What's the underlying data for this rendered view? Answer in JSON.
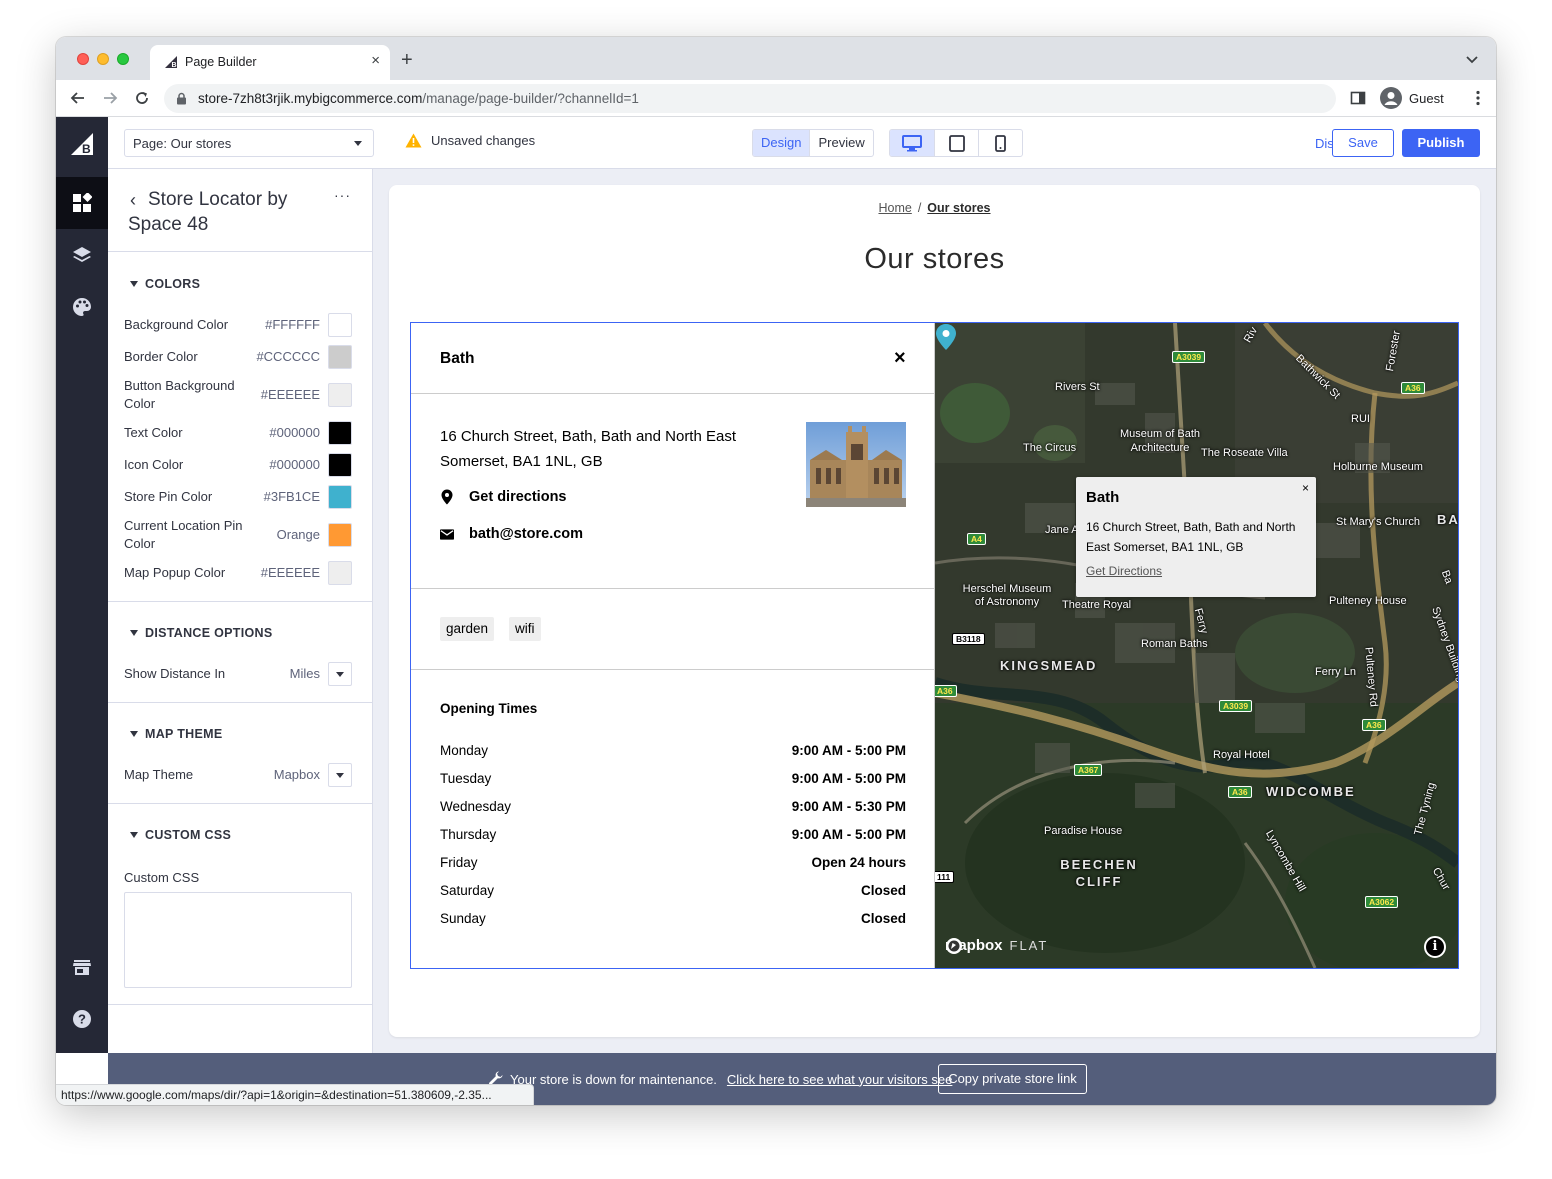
{
  "browser": {
    "tab_title": "Page Builder",
    "new_tab": "+",
    "tab_close": "×",
    "url_host": "store-7zh8t3rjik.mybigcommerce.com",
    "url_path": "/manage/page-builder/?channelId=1",
    "profile_label": "Guest",
    "status_url": "https://www.google.com/maps/dir/?api=1&origin=&destination=51.380609,-2.35..."
  },
  "topbar": {
    "page_select": "Page: Our stores",
    "unsaved": "Unsaved changes",
    "design": "Design",
    "preview": "Preview",
    "discard": "Discard",
    "save": "Save",
    "publish": "Publish"
  },
  "panel": {
    "title": "Store Locator by Space 48",
    "more": "···",
    "colors": {
      "heading": "COLORS",
      "rows": [
        {
          "label": "Background Color",
          "value": "#FFFFFF",
          "swatch": "#FFFFFF"
        },
        {
          "label": "Border Color",
          "value": "#CCCCCC",
          "swatch": "#CCCCCC"
        },
        {
          "label": "Button Background Color",
          "value": "#EEEEEE",
          "swatch": "#EEEEEE"
        },
        {
          "label": "Text Color",
          "value": "#000000",
          "swatch": "#000000"
        },
        {
          "label": "Icon Color",
          "value": "#000000",
          "swatch": "#000000"
        },
        {
          "label": "Store Pin Color",
          "value": "#3FB1CE",
          "swatch": "#3FB1CE"
        },
        {
          "label": "Current Location Pin Color",
          "value": "Orange",
          "swatch": "#FF9933"
        },
        {
          "label": "Map Popup Color",
          "value": "#EEEEEE",
          "swatch": "#EEEEEE"
        }
      ]
    },
    "distance": {
      "heading": "DISTANCE OPTIONS",
      "label": "Show Distance In",
      "value": "Miles"
    },
    "map_theme": {
      "heading": "MAP THEME",
      "label": "Map Theme",
      "value": "Mapbox"
    },
    "custom_css": {
      "heading": "CUSTOM CSS",
      "label": "Custom CSS",
      "value": ""
    }
  },
  "page": {
    "breadcrumb_home": "Home",
    "breadcrumb_sep": "/",
    "breadcrumb_current": "Our stores",
    "title": "Our stores"
  },
  "store": {
    "name": "Bath",
    "close": "×",
    "address": "16 Church Street, Bath, Bath and North East Somerset, BA1 1NL, GB",
    "directions": "Get directions",
    "email": "bath@store.com",
    "tags": [
      "garden",
      "wifi"
    ],
    "hours_title": "Opening Times",
    "hours": [
      {
        "day": "Monday",
        "time": "9:00 AM - 5:00 PM"
      },
      {
        "day": "Tuesday",
        "time": "9:00 AM - 5:00 PM"
      },
      {
        "day": "Wednesday",
        "time": "9:00 AM - 5:30 PM"
      },
      {
        "day": "Thursday",
        "time": "9:00 AM - 5:00 PM"
      },
      {
        "day": "Friday",
        "time": "Open 24 hours"
      },
      {
        "day": "Saturday",
        "time": "Closed"
      },
      {
        "day": "Sunday",
        "time": "Closed"
      }
    ]
  },
  "map": {
    "popup_title": "Bath",
    "popup_close": "×",
    "popup_address": "16 Church Street, Bath, Bath and North East Somerset, BA1 1NL, GB",
    "popup_link": "Get Directions",
    "pin_color": "#3FB1CE",
    "attribution_logo": "mapbox",
    "attribution_style": "FLAT",
    "info": "i",
    "labels": [
      "Rivers St",
      "The Circus",
      "Museum of Bath Architecture",
      "The Roseate Villa",
      "RUI",
      "Holburne Museum",
      "St Mary's Church",
      "BA",
      "Jane A",
      "Herschel Museum of Astronomy",
      "Theatre Royal",
      "Pulteney House",
      "Roman Baths",
      "KINGSMEAD",
      "Ferry Ln",
      "Royal Hotel",
      "WIDCOMBE",
      "Paradise House",
      "BEECHEN CLIFF",
      "Bathwick St",
      "Forester",
      "Sydney Buildings",
      "Pulteney Rd",
      "Lyncombe Hill",
      "The Tyning",
      "Chur",
      "Ba",
      "Riv",
      "Ferry"
    ],
    "shields": [
      "A3039",
      "A36",
      "A4",
      "B3118",
      "A36",
      "A3039",
      "A367",
      "A36",
      "A36",
      "A3062",
      "111"
    ]
  },
  "maintenance": {
    "text": "Your store is down for maintenance.",
    "link": "Click here to see what your visitors see",
    "button": "Copy private store link"
  }
}
